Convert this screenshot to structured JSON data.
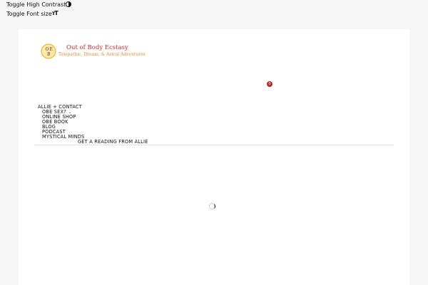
{
  "accessibility": {
    "items": [
      {
        "label": "Toggle High Contrast",
        "icon": "contrast-icon"
      },
      {
        "label": "Toggle Font size",
        "icon": "font-size-icon"
      }
    ]
  },
  "header": {
    "logo": {
      "letters": [
        "O",
        "E",
        "B"
      ],
      "icon": "obe-logo"
    },
    "title": "Out of Body Ecstasy",
    "tagline": "Telepathic, Dream, & Astral Adventures",
    "cart_count": "0"
  },
  "nav": {
    "items": [
      {
        "label": "ALLIE + CONTACT"
      },
      {
        "label": "OBE SEX?",
        "has_dropdown": true
      },
      {
        "label": "ONLINE SHOP"
      },
      {
        "label": "OBE BOOK"
      },
      {
        "label": "BLOG"
      },
      {
        "label": "PODCAST"
      },
      {
        "label": "MYSTICAL MINDS"
      },
      {
        "label": "GET A READING FROM ALLIE"
      }
    ]
  },
  "main": {
    "loading_icon": "spinner-icon"
  },
  "colors": {
    "brand_red": "#c2292e",
    "brand_orange": "#e08b36",
    "badge": "#b22b2b",
    "page_bg": "#f6f6f6"
  }
}
